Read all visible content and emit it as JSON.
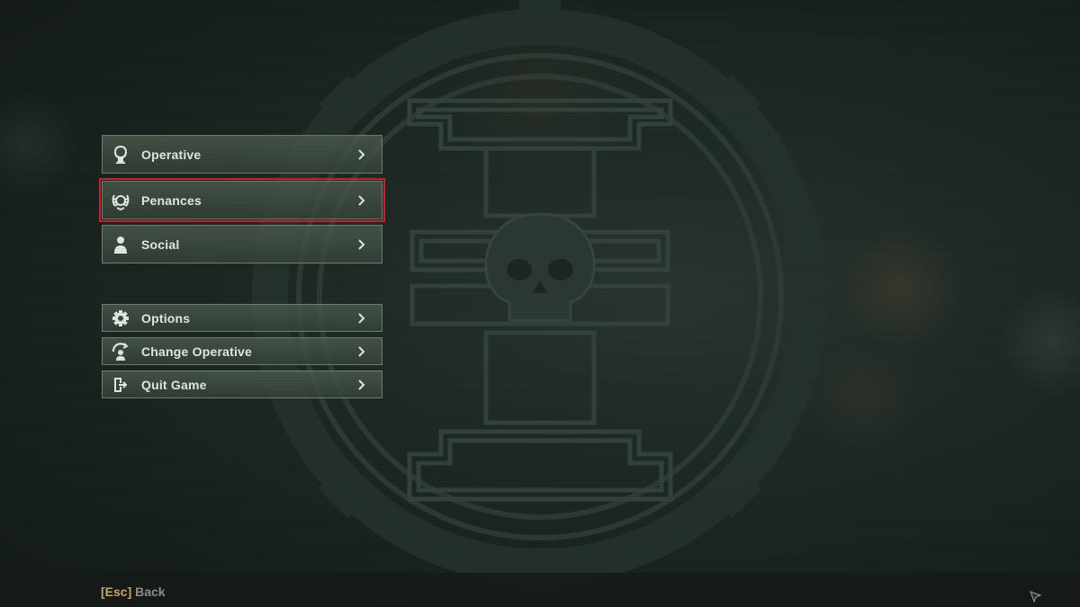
{
  "menu": {
    "items": [
      {
        "label": "Operative",
        "icon": "operative-bust-icon"
      },
      {
        "label": "Penances",
        "icon": "laurel-wreath-icon",
        "selected": true
      },
      {
        "label": "Social",
        "icon": "person-icon"
      },
      {
        "label": "Options",
        "icon": "gear-icon"
      },
      {
        "label": "Change Operative",
        "icon": "swap-operative-icon"
      },
      {
        "label": "Quit Game",
        "icon": "exit-door-icon"
      }
    ]
  },
  "footer": {
    "key": "[Esc]",
    "action": "Back"
  },
  "colors": {
    "selection_outline": "#d0202a",
    "key_hint": "#c9a467",
    "button_text": "#e4e8e1"
  }
}
